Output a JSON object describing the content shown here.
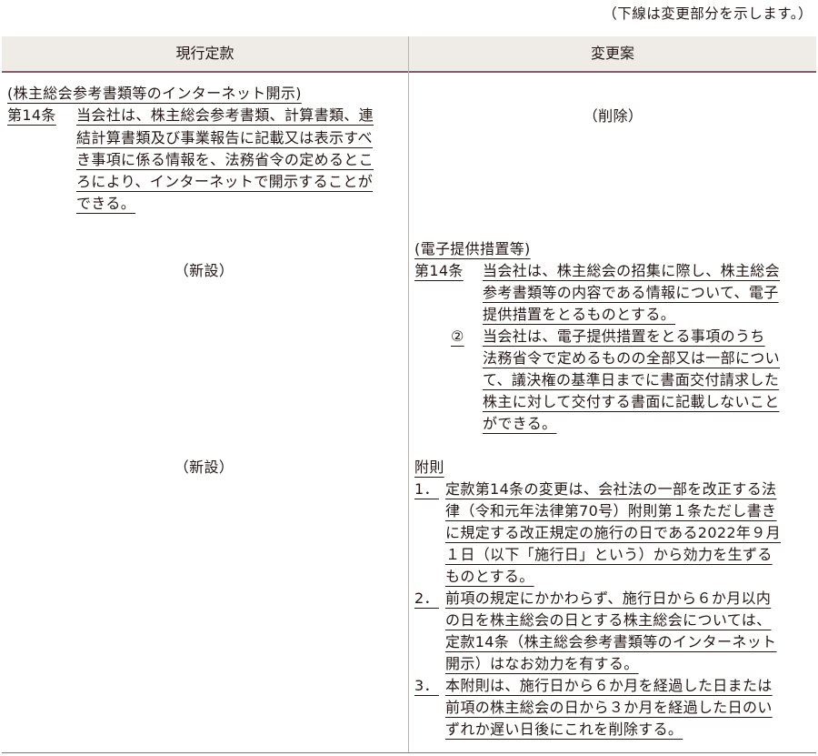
{
  "note": "（下線は変更部分を示します。）",
  "header": {
    "current": "現行定款",
    "proposed": "変更案"
  },
  "left": {
    "art14_heading": "(株主総会参考書類等のインターネット開示)",
    "art14_label": "第14条",
    "art14_lines": [
      "当会社は、株主総会参考書類、計算書類、連",
      "結計算書類及び事業報告に記載又は表示すべ",
      "き事項に係る情報を、法務省令の定めるとこ",
      "ろにより、インターネットで開示することが",
      "できる。"
    ],
    "new1": "（新設）",
    "new2": "（新設）"
  },
  "right": {
    "deleted": "（削除）",
    "art14_heading": "(電子提供措置等)",
    "art14_label": "第14条",
    "art14_lines": [
      "当会社は、株主総会の招集に際し、株主総会",
      "参考書類等の内容である情報について、電子",
      "提供措置をとるものとする。"
    ],
    "para2_label": "②",
    "para2_lines": [
      "当会社は、電子提供措置をとる事項のうち",
      "法務省令で定めるものの全部又は一部につい",
      "て、議決権の基準日までに書面交付請求した",
      "株主に対して交付する書面に記載しないこと",
      "ができる。"
    ],
    "supp_heading": "附則",
    "supp_items": [
      {
        "num": "1．",
        "lines": [
          "定款第14条の変更は、会社法の一部を改正する法",
          "律（令和元年法律第70号）附則第１条ただし書き",
          "に規定する改正規定の施行の日である2022年９月",
          "１日（以下「施行日」という）から効力を生ずる",
          "ものとする。"
        ]
      },
      {
        "num": "2．",
        "lines": [
          "前項の規定にかかわらず、施行日から６か月以内",
          "の日を株主総会の日とする株主総会については、",
          "定款14条（株主総会参考書類等のインターネット",
          "開示）はなお効力を有する。"
        ]
      },
      {
        "num": "3．",
        "lines": [
          "本附則は、施行日から６か月を経過した日または",
          "前項の株主総会の日から３か月を経過した日のい",
          "ずれか遅い日後にこれを削除する。"
        ]
      }
    ]
  }
}
